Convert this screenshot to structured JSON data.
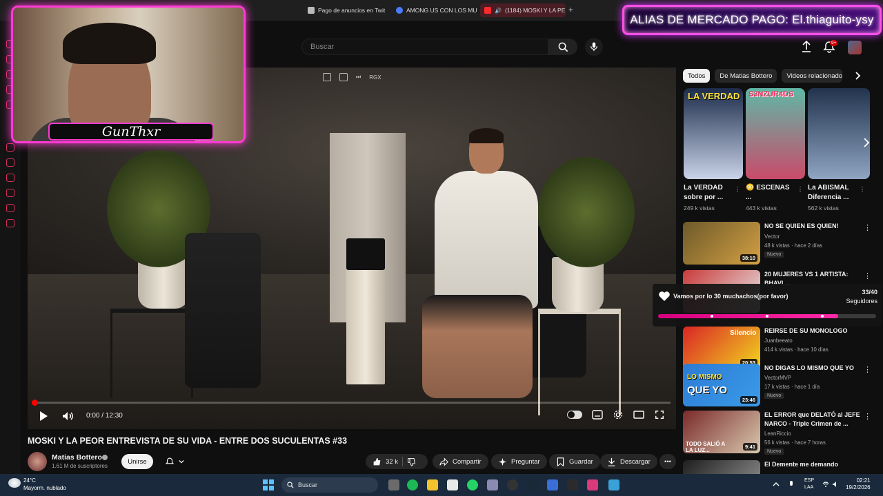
{
  "browser": {
    "tabs": [
      {
        "label": "Pago de anuncios en Twit",
        "color": "#bbbbbb"
      },
      {
        "label": "AMONG US CON LOS MU",
        "color": "#4a7cff"
      },
      {
        "label": "(1184) MOSKI Y LA PE",
        "color": "#ff2a2a"
      }
    ]
  },
  "alias_banner": "ALIAS DE MERCADO PAGO: El.thiaguito-ysy",
  "header": {
    "search_placeholder": "Buscar",
    "notif_badge": "9+"
  },
  "webcam": {
    "name": "GunThxr"
  },
  "player": {
    "icons": [
      "pip-icon",
      "exit-icon",
      "skip-icon"
    ],
    "icon_text": "RGX",
    "time": "0:00 / 12:30",
    "progress_fraction": 0.0
  },
  "video": {
    "title": "MOSKI Y LA PEOR ENTREVISTA DE SU VIDA - ENTRE DOS SUCULENTAS #33",
    "channel": "Matias Bottero",
    "subscribers": "1.61 M de suscriptores",
    "join": "Unirse",
    "likes": "32 k",
    "share": "Compartir",
    "ask": "Preguntar",
    "save": "Guardar",
    "download": "Descargar"
  },
  "chips": [
    "Todos",
    "De Matias Bottero",
    "Videos relacionado"
  ],
  "shorts": [
    {
      "title": "La VERDAD sobre por ...",
      "views": "249 k vistas",
      "thumb_text": "LA VERDAD",
      "thumb_colors": [
        "#1c2c4a",
        "#c9d3e8"
      ]
    },
    {
      "title": "😳 ESCENAS ...",
      "views": "443 k vistas",
      "thumb_text": "S3NZUR4DS",
      "thumb_colors": [
        "#5fb8a6",
        "#c94b6a"
      ]
    },
    {
      "title": "La ABISMAL Diferencia ...",
      "views": "562 k vistas",
      "thumb_text": "",
      "thumb_colors": [
        "#22334d",
        "#8fa5c2"
      ]
    }
  ],
  "recommendations": [
    {
      "title": "NO SE QUIEN ES QUIEN!",
      "channel": "Vector",
      "meta": "48 k vistas · hace 2 días",
      "badge": "Nuevo",
      "duration": "38:10",
      "colors": [
        "#6d5a2a",
        "#d4a043"
      ]
    },
    {
      "title": "20 MUJERES VS 1 ARTISTA: BHAVI ...",
      "channel": "",
      "meta": "",
      "badge": "",
      "duration": "",
      "colors": [
        "#c93a3a",
        "#e8e8e8"
      ]
    },
    {
      "title": "REIRSE DE SU MONOLOGO",
      "channel": "Juanbeeato",
      "meta": "414 k vistas · hace 10 días",
      "badge": "",
      "duration": "20:53",
      "colors": [
        "#d92525",
        "#f2d61f"
      ]
    },
    {
      "title": "NO DIGAS LO MISMO QUE YO",
      "channel": "VectorMVP",
      "meta": "17 k vistas · hace 1 día",
      "badge": "Nuevo",
      "duration": "23:46",
      "colors": [
        "#2d7bd4",
        "#f5e43a"
      ]
    },
    {
      "title": "EL ERROR que DELATÓ al JEFE NARCO - Triple Crimen de ...",
      "channel": "LeanRiccio",
      "meta": "56 k vistas · hace 7 horas",
      "badge": "Nuevo",
      "duration": "9:41",
      "colors": [
        "#7a2a2a",
        "#d9c9b0"
      ]
    },
    {
      "title": "El Demente me demando",
      "channel": "",
      "meta": "",
      "badge": "",
      "duration": "",
      "colors": [
        "#1f1f1f",
        "#9a9a9a"
      ]
    }
  ],
  "thumb_texts": {
    "r2": "Silencio",
    "r3a": "LO MISMO",
    "r3b": "QUE YO",
    "r4": "TODO SALIÓ A LA LUZ..."
  },
  "goal": {
    "text": "Vamos por lo 30 muchachos(por favor)",
    "count": "33/40",
    "label": "Seguidores",
    "fraction": 0.825
  },
  "taskbar": {
    "temp": "24°C",
    "weather": "Mayorm. nublado",
    "search": "Buscar",
    "lang1": "ESP",
    "lang2": "LAA",
    "time": "02:21",
    "date": "19/2/2026"
  }
}
